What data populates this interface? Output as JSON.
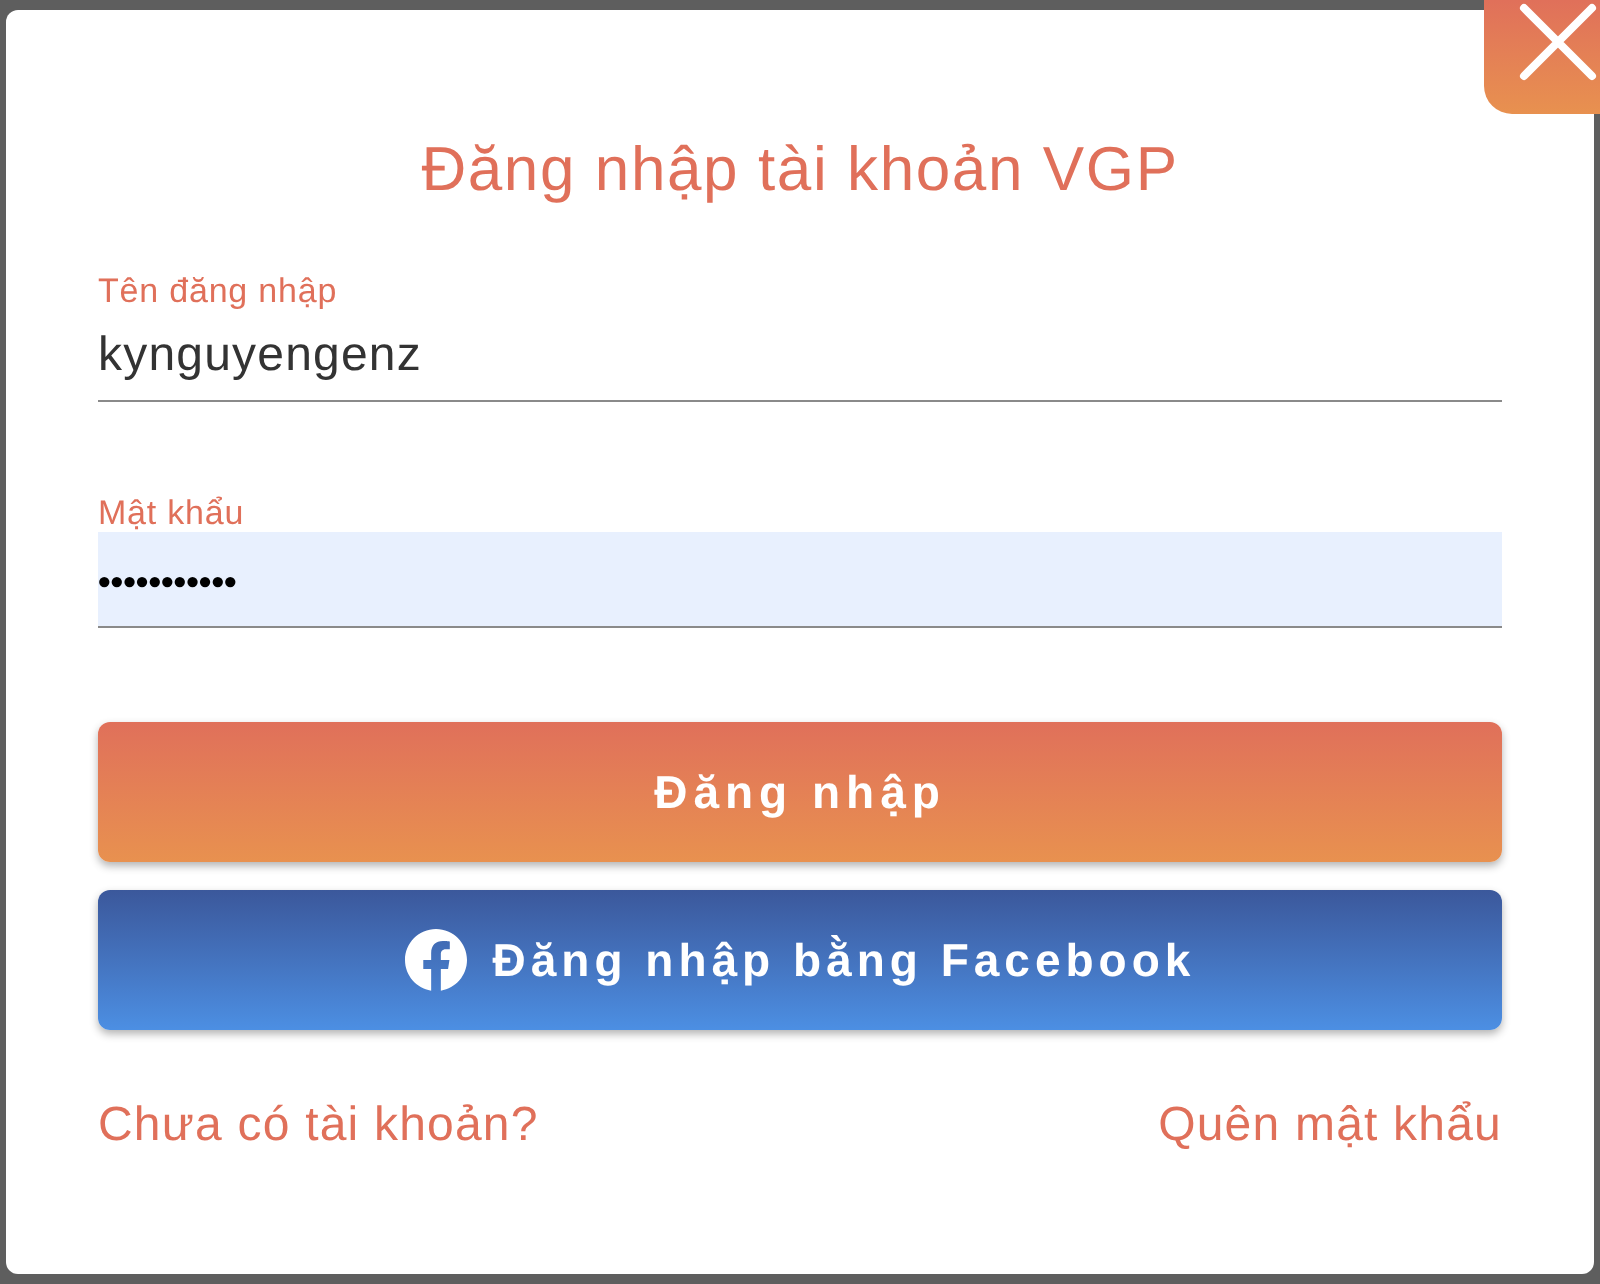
{
  "title": "Đăng nhập tài khoản VGP",
  "fields": [
    {
      "kind": "text",
      "label": "Tên đăng nhập",
      "value": "kynguyengenz",
      "autofilled": false
    },
    {
      "kind": "password",
      "label": "Mật khẩu",
      "value": "•••••••••••",
      "autofilled": true
    }
  ],
  "buttons": [
    {
      "kind": "primary",
      "label": "Đăng nhập"
    },
    {
      "kind": "facebook",
      "label": "Đăng nhập bằng Facebook"
    }
  ],
  "links": [
    {
      "label": "Chưa có tài khoản?"
    },
    {
      "label": "Quên mật khẩu"
    }
  ]
}
